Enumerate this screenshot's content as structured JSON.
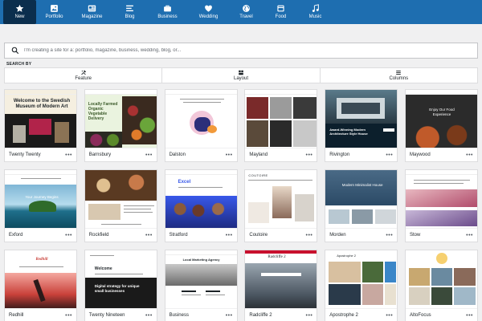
{
  "nav": {
    "items": [
      {
        "label": "New",
        "icon": "star-icon",
        "active": true
      },
      {
        "label": "Portfolio",
        "icon": "image-icon"
      },
      {
        "label": "Magazine",
        "icon": "newspaper-icon"
      },
      {
        "label": "Blog",
        "icon": "lines-icon"
      },
      {
        "label": "Business",
        "icon": "briefcase-icon"
      },
      {
        "label": "Wedding",
        "icon": "heart-icon"
      },
      {
        "label": "Travel",
        "icon": "globe-icon"
      },
      {
        "label": "Food",
        "icon": "food-icon"
      },
      {
        "label": "Music",
        "icon": "music-icon"
      }
    ]
  },
  "search": {
    "placeholder": "I'm creating a site for a: portfolio, magazine, business, wedding, blog, or...",
    "value": ""
  },
  "search_by": "SEARCH BY",
  "filters": [
    {
      "label": "Feature",
      "icon": "tools-icon"
    },
    {
      "label": "Layout",
      "icon": "layout-icon"
    },
    {
      "label": "Columns",
      "icon": "columns-icon"
    }
  ],
  "more_label": "•••",
  "themes": [
    {
      "name": "Twenty Twenty",
      "headline": "Welcome to the Swedish Museum of Modern Art",
      "accent": "#cd2653"
    },
    {
      "name": "Barnsbury",
      "headline": "Locally Farmed Organic Vegetable Delivery",
      "accent": "#3b5a2a"
    },
    {
      "name": "Dalston",
      "accent": "#2c2f7a"
    },
    {
      "name": "Mayland",
      "accent": "#222222"
    },
    {
      "name": "Rivington",
      "headline": "Award-Winning Modern Architecture Style House",
      "accent": "#0c1f2c"
    },
    {
      "name": "Maywood",
      "headline": "Enjoy Our Food Experience",
      "accent": "#2b2b2b"
    },
    {
      "name": "Exford",
      "headline": "Your Journey Begins",
      "accent": "#1f6f8b"
    },
    {
      "name": "Rockfield",
      "accent": "#8a6a4a"
    },
    {
      "name": "Stratford",
      "headline": "Excel",
      "accent": "#3858e9"
    },
    {
      "name": "Coutoire",
      "headline": "COUTOIRE",
      "accent": "#d8d3cc"
    },
    {
      "name": "Morden",
      "headline": "Modern Minimalist House",
      "accent": "#2b4a66"
    },
    {
      "name": "Stow",
      "accent": "#e8b8c0"
    },
    {
      "name": "Redhill",
      "headline": "Redhill",
      "accent": "#c9413a"
    },
    {
      "name": "Twenty Nineteen",
      "headline": "Welcome",
      "subline": "Digital strategy for unique small businesses",
      "accent": "#1a1a1a"
    },
    {
      "name": "Business",
      "headline": "Local Marketing Agency",
      "accent": "#1d1d1d"
    },
    {
      "name": "Radcliffe 2",
      "headline": "Radcliffe 2",
      "accent": "#c8102e"
    },
    {
      "name": "Apostrophe 2",
      "headline": "Apostrophe 2",
      "accent": "#3a86c8"
    },
    {
      "name": "AltoFocus",
      "accent": "#e0a030"
    }
  ]
}
